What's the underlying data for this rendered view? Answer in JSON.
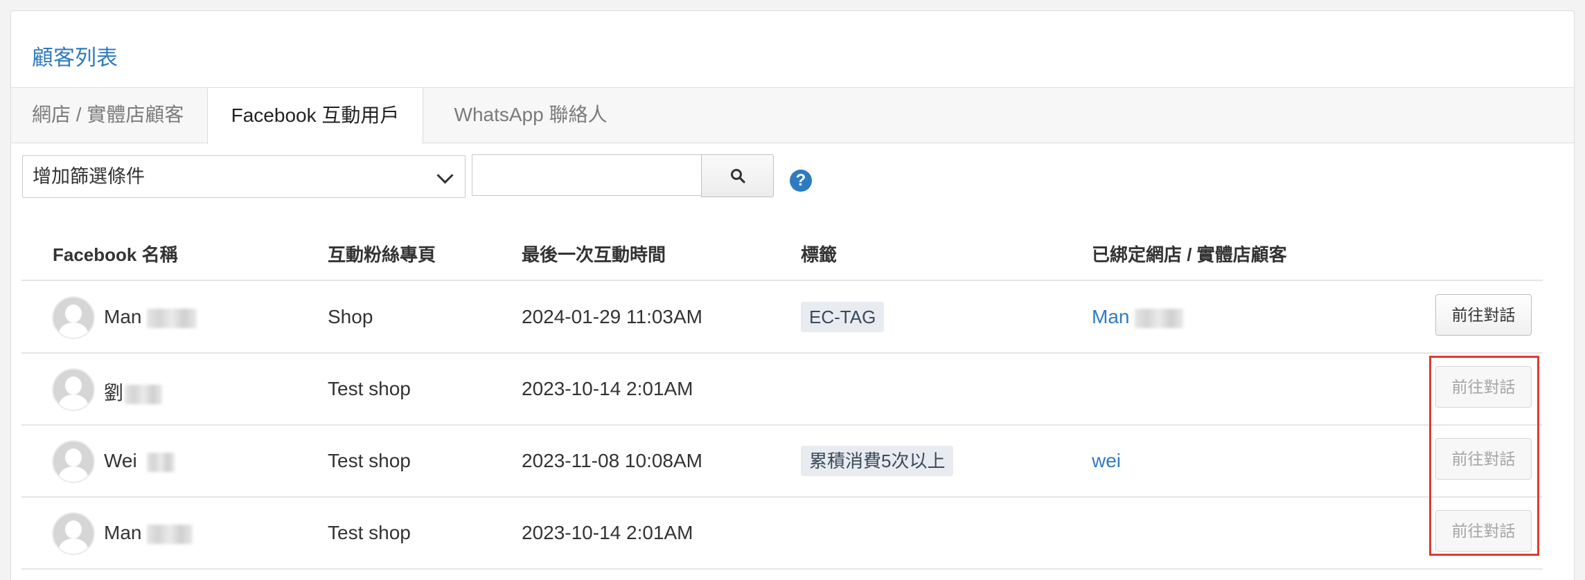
{
  "panel": {
    "title": "顧客列表"
  },
  "tabs": [
    {
      "label": "網店 / 實體店顧客",
      "active": false
    },
    {
      "label": "Facebook 互動用戶",
      "active": true
    },
    {
      "label": "WhatsApp 聯絡人",
      "active": false
    }
  ],
  "filter": {
    "select_value": "增加篩選條件",
    "search_value": "",
    "help_icon": "question-circle-icon",
    "search_icon": "magnifier-icon"
  },
  "table": {
    "headers": [
      "Facebook 名稱",
      "互動粉絲專頁",
      "最後一次互動時間",
      "標籤",
      "已綁定網店 / 實體店顧客"
    ],
    "rows": [
      {
        "name": "Man",
        "page": "Shop",
        "time": "2024-01-29 11:03AM",
        "tag": "EC-TAG",
        "bound": "Man",
        "button": "前往對話",
        "button_disabled": false
      },
      {
        "name": "劉",
        "page": "Test shop",
        "time": "2023-10-14 2:01AM",
        "tag": "",
        "bound": "",
        "button": "前往對話",
        "button_disabled": true
      },
      {
        "name": "Wei",
        "page": "Test shop",
        "time": "2023-11-08 10:08AM",
        "tag": "累積消費5次以上",
        "bound": "wei",
        "button": "前往對話",
        "button_disabled": true
      },
      {
        "name": "Man",
        "page": "Test shop",
        "time": "2023-10-14 2:01AM",
        "tag": "",
        "bound": "",
        "button": "前往對話",
        "button_disabled": true
      }
    ]
  },
  "colors": {
    "accent": "#2f7bc1",
    "highlight": "#e03a2f"
  }
}
